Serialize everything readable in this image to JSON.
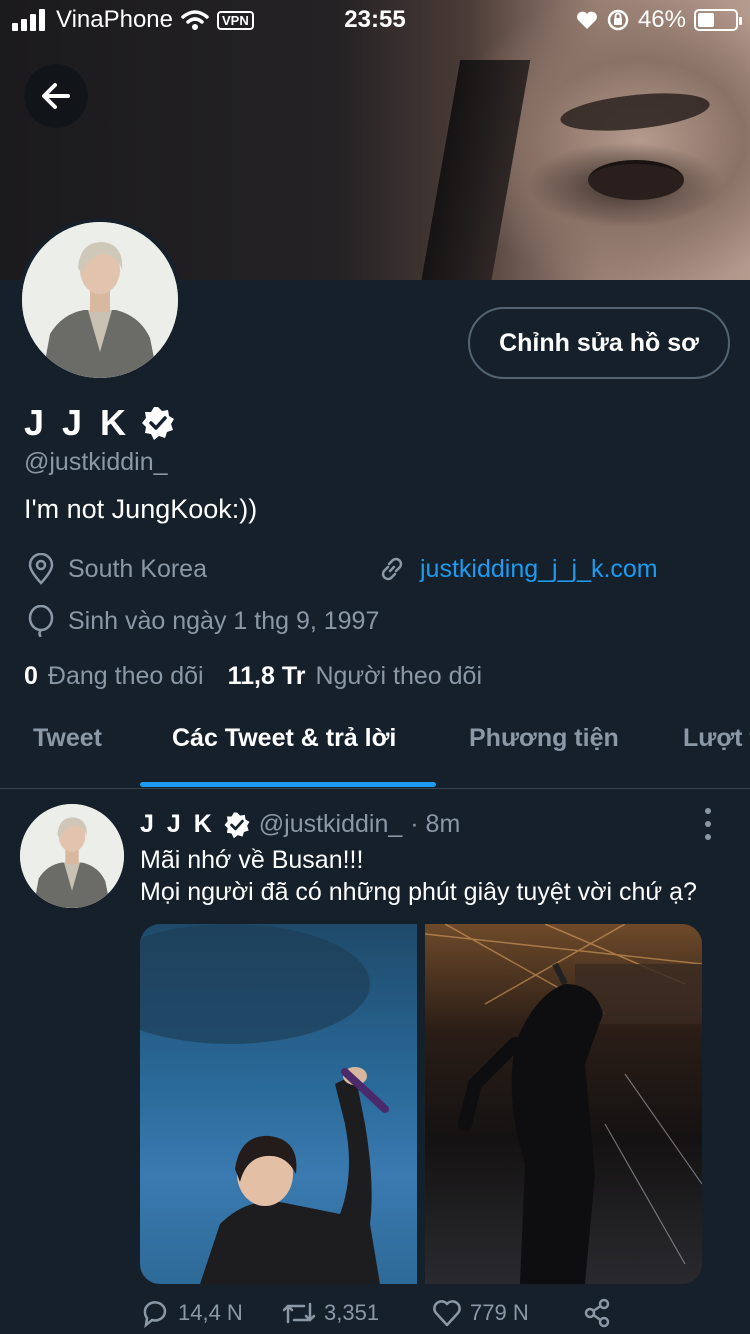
{
  "status_bar": {
    "carrier": "VinaPhone",
    "vpn": "VPN",
    "time": "23:55",
    "battery": "46%"
  },
  "profile": {
    "edit_button": "Chỉnh sửa hồ sơ",
    "name": "J J K",
    "handle": "@justkiddin_",
    "bio": "I'm not JungKook:))",
    "location": "South Korea",
    "website": "justkidding_j_j_k.com",
    "birthday": "Sinh vào ngày 1 thg 9, 1997",
    "following_count": "0",
    "following_label": "Đang theo dõi",
    "followers_count": "11,8 Tr",
    "followers_label": "Người theo dõi"
  },
  "tabs": [
    {
      "label": "Tweet"
    },
    {
      "label": "Các Tweet & trả lời"
    },
    {
      "label": "Phương tiện"
    },
    {
      "label": "Lượt t"
    }
  ],
  "tweet": {
    "name": "J J K",
    "handle": "@justkiddin_",
    "time": "· 8m",
    "line1": "Mãi nhớ về Busan!!!",
    "line2": "Mọi người đã có những phút giây tuyệt vời chứ ạ?",
    "replies": "14,4 N",
    "retweets": "3,351",
    "likes": "779 N"
  },
  "colors": {
    "background": "#15202b",
    "accent": "#1d9bf0",
    "secondary_text": "#8b98a5"
  }
}
